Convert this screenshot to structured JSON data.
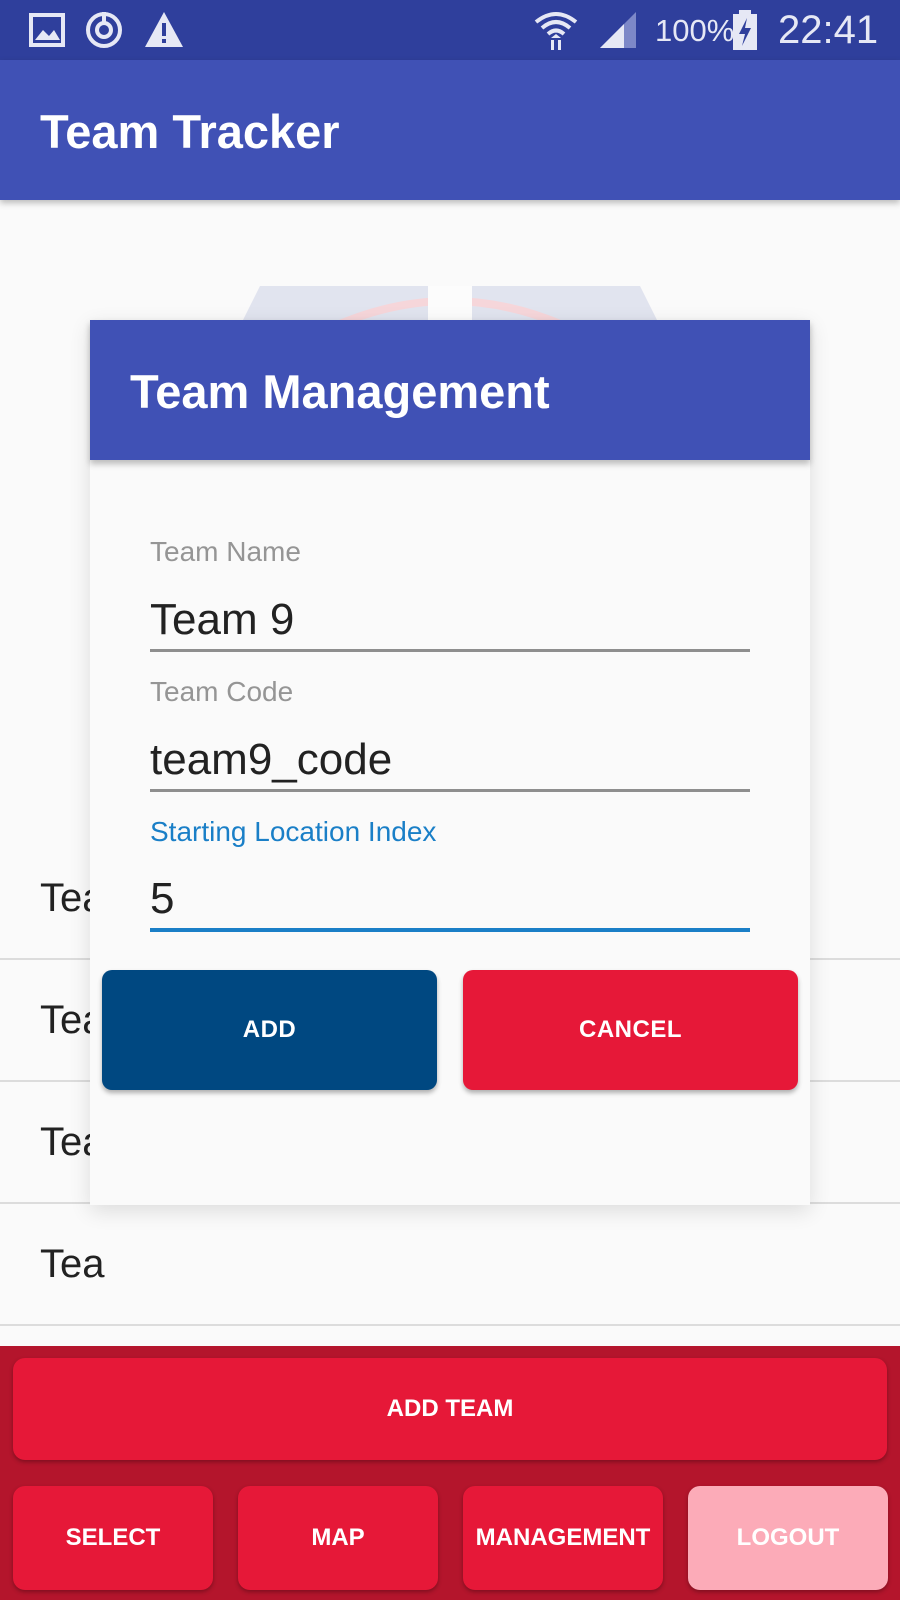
{
  "status_bar": {
    "icons": [
      "gallery-icon",
      "sync-icon",
      "warning-icon",
      "wifi-icon",
      "signal-icon",
      "battery-charging-icon"
    ],
    "battery": "100%",
    "time": "22:41"
  },
  "app_bar": {
    "title": "Team Tracker"
  },
  "team_list": {
    "rows": [
      {
        "label": "Tea"
      },
      {
        "label": "Tea"
      },
      {
        "label": "Tea"
      },
      {
        "label": "Tea"
      }
    ]
  },
  "dialog": {
    "title": "Team Management",
    "fields": [
      {
        "label": "Team Name",
        "value": "Team 9"
      },
      {
        "label": "Team Code",
        "value": "team9_code"
      },
      {
        "label": "Starting Location Index",
        "value": "5"
      }
    ],
    "add_label": "ADD",
    "cancel_label": "CANCEL"
  },
  "bottom_panel": {
    "add_team_label": "ADD TEAM",
    "select_label": "SELECT",
    "map_label": "MAP",
    "management_label": "MANAGEMENT",
    "logout_label": "LOGOUT"
  },
  "colors": {
    "primary": "#4051b5",
    "status_bar": "#2f3f9c",
    "accent_red": "#e61838",
    "add_blue": "#004881",
    "focus_blue": "#1a7fc7",
    "logout_pink": "#fcabb8"
  }
}
